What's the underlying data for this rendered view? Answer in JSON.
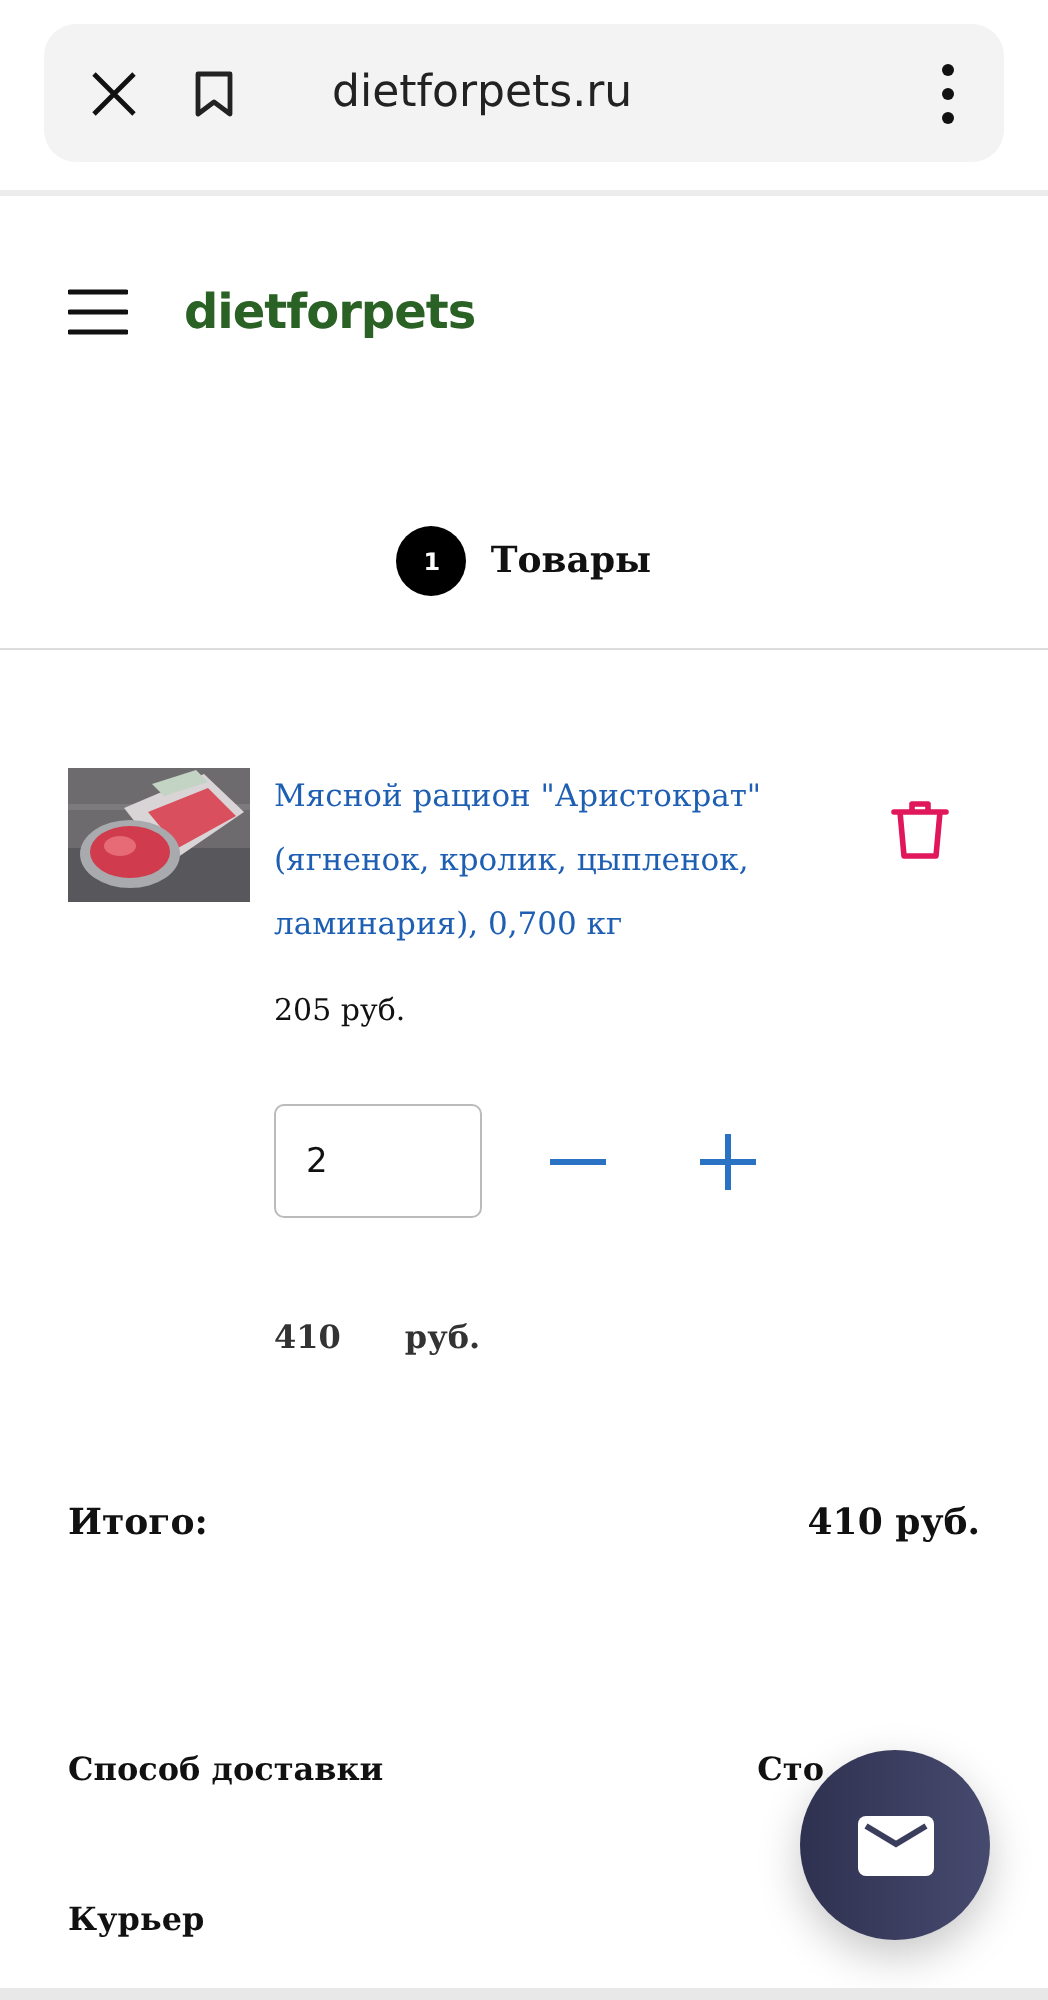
{
  "browser": {
    "url": "dietforpets.ru"
  },
  "header": {
    "logo": "dietforpets"
  },
  "steps": [
    {
      "number": "1",
      "label": "Товары"
    }
  ],
  "cart": {
    "items": [
      {
        "title": "Мясной рацион \"Аристократ\" (ягненок, кролик, цыпленок, ламинария), 0,700 кг",
        "price": "205 руб.",
        "quantity": "2",
        "sum": "410",
        "sum_currency": "руб."
      }
    ],
    "total": {
      "label": "Итого:",
      "value": "410 руб."
    }
  },
  "delivery": {
    "columns": [
      "Способ доставки",
      "Сто"
    ],
    "rows": [
      {
        "method": "Курьер"
      }
    ]
  }
}
